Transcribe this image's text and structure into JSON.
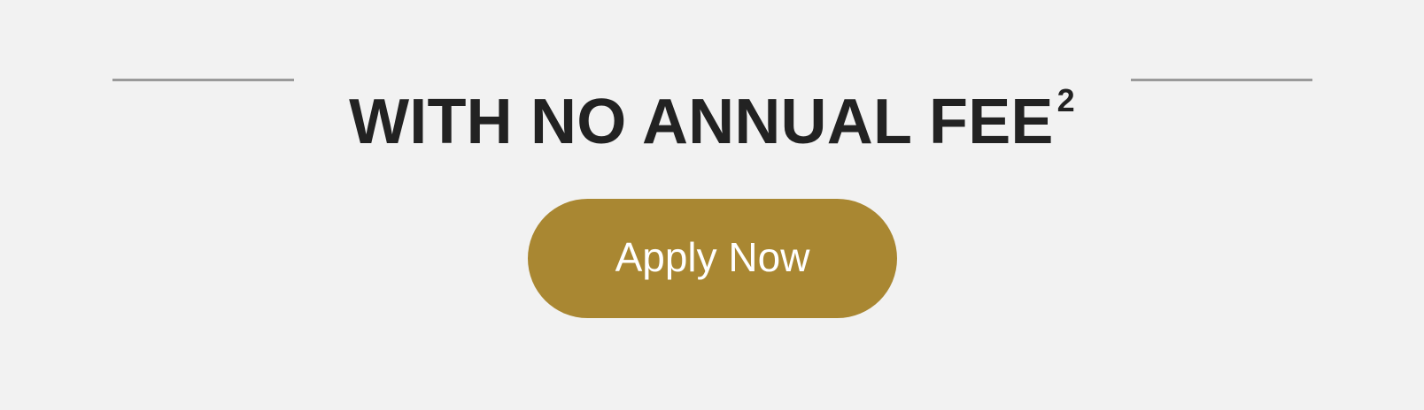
{
  "headline": {
    "text": "WITH NO ANNUAL FEE",
    "footnote": "2"
  },
  "cta": {
    "label": "Apply Now"
  },
  "colors": {
    "background": "#f2f2f2",
    "headline": "#222222",
    "rule": "#9a9a9a",
    "button": "#a98732",
    "button_text": "#ffffff"
  }
}
